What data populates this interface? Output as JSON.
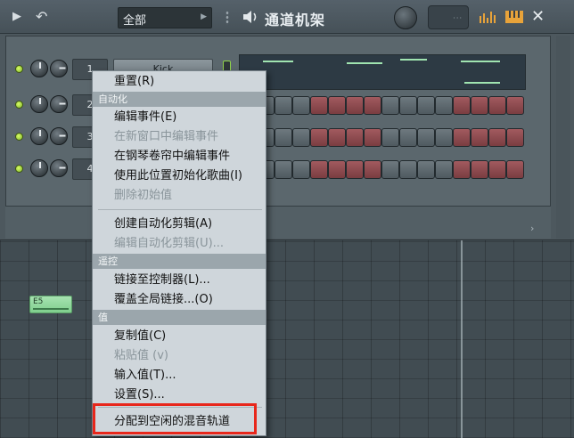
{
  "window": {
    "title": "通道机架",
    "filter_value": "全部",
    "icons": [
      "play-arrow-icon",
      "undo-icon",
      "speaker-icon",
      "graph-editor-icon",
      "piano-roll-icon",
      "close-icon"
    ]
  },
  "channels": [
    {
      "mixer_track": "1",
      "name": "Kick"
    },
    {
      "mixer_track": "2",
      "name": ""
    },
    {
      "mixer_track": "3",
      "name": ""
    },
    {
      "mixer_track": "4",
      "name": ""
    }
  ],
  "step_colors": [
    "gray",
    "gray",
    "gray",
    "gray",
    "red",
    "red",
    "red",
    "red",
    "gray",
    "gray",
    "gray",
    "gray",
    "red",
    "red",
    "red",
    "red"
  ],
  "note_block_label": "E5",
  "context_menu": {
    "reset": "重置(R)",
    "section_automation": "自动化",
    "edit_events": "编辑事件(E)",
    "edit_events_new_window": "在新窗口中编辑事件",
    "edit_events_piano_roll": "在钢琴卷帘中编辑事件",
    "init_song_here": "使用此位置初始化歌曲(I)",
    "delete_init_value": "删除初始值",
    "create_automation_clip": "创建自动化剪辑(A)",
    "edit_automation_clip": "编辑自动化剪辑(U)...",
    "section_remote": "遥控",
    "link_to_controller": "链接至控制器(L)...",
    "override_global_link": "覆盖全局链接...(O)",
    "section_value": "值",
    "copy_value": "复制值(C)",
    "paste_value": "粘贴值 (v)",
    "type_in_value": "输入值(T)...",
    "settings": "设置(S)...",
    "assign_free_mixer_track": "分配到空闲的混音轨道"
  },
  "colors": {
    "highlight": "#e8271b",
    "led_green": "#9bd43a",
    "step_red": "#8f4a4f"
  }
}
